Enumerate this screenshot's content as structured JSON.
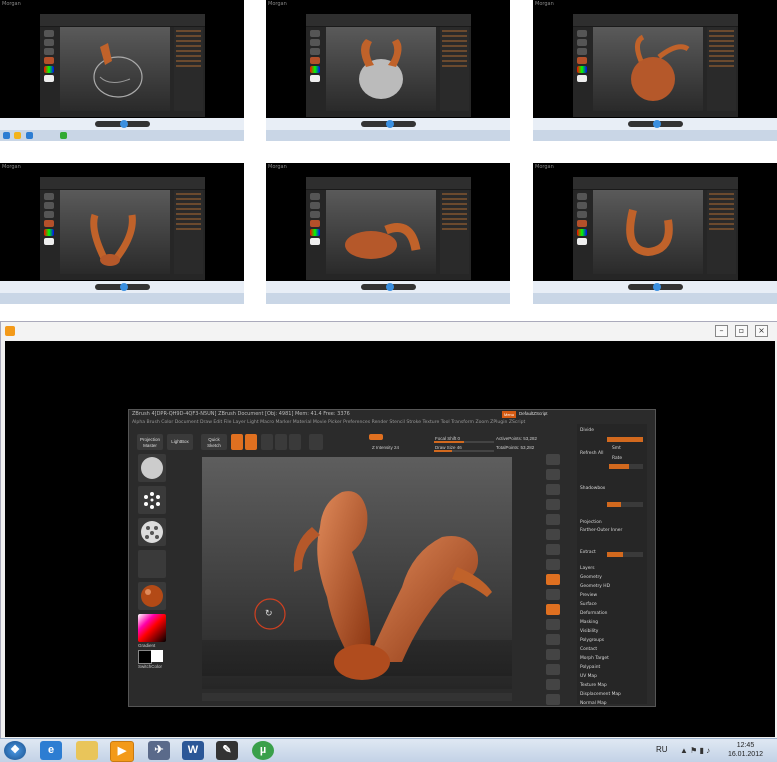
{
  "thumbnails": [
    {
      "title": "Morgan"
    },
    {
      "title": "Morgan"
    },
    {
      "title": "Morgan"
    },
    {
      "title": "Morgan"
    },
    {
      "title": "Morgan"
    },
    {
      "title": "Morgan"
    }
  ],
  "zbrush": {
    "title": "ZBrush 4[DPR-QH9D-4QF3-N5UN]   ZBrush Document   [Obj: 4981] Mem: 41.4  Free: 3376",
    "menus": "Alpha  Brush  Color  Document  Draw  Edit  File  Layer  Light  Macro  Marker  Material  Movie  Picker  Preferences  Render  Stencil  Stroke  Texture  Tool  Transform  Zoom  ZPlugin  ZScript",
    "menu_head": "Menu",
    "default_script": "DefaultZScript",
    "projection_master": "Projection Master",
    "lightbox": "LightBox",
    "quick_sketch": "Quick Sketch",
    "focal_shift": "Focal Shift 0",
    "draw_size": "Draw Size 46",
    "z_intensity": "Z Intensity 24",
    "active_points": "ActivePoints: 53,282",
    "total_points": "TotalPoints: 53,282",
    "gradient": "Gradient",
    "switch_color": "SwitchColor",
    "panel": {
      "items": [
        "Layers",
        "Geometry",
        "Geometry HD",
        "Preview",
        "Surface",
        "Deformation",
        "Masking",
        "Visibility",
        "Polygroups",
        "Contact",
        "Morph Target",
        "Polypaint",
        "UV Map",
        "Texture Map",
        "Displacement Map",
        "Normal Map"
      ],
      "top_labels": [
        "Divide",
        "Smt",
        "Rate",
        "Refresh All",
        "Sub-D  1",
        "ReLock",
        "Shadowbox",
        "Projection",
        "Farther-Outer  Inner",
        "Extract"
      ]
    }
  },
  "taskbar": {
    "lang": "RU",
    "time": "12:45",
    "date": "16.01.2012",
    "word_icon": "W"
  }
}
